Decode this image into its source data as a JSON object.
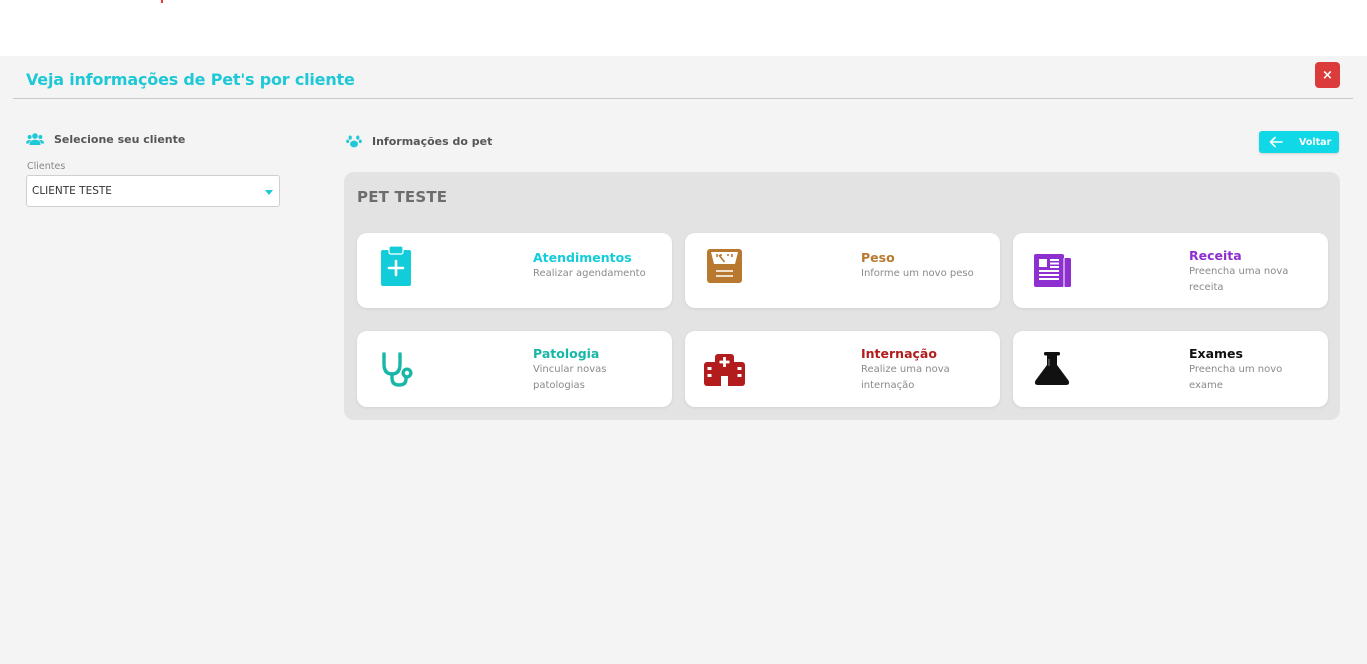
{
  "modal": {
    "title": "Veja informações de Pet's por cliente",
    "close_label": "×"
  },
  "client_section": {
    "heading": "Selecione seu cliente",
    "field_label": "Clientes",
    "selected_value": "CLIENTE TESTE"
  },
  "pet_section": {
    "heading": "Informações do pet",
    "back_label": "Voltar",
    "pet_name": "PET TESTE"
  },
  "cards": [
    {
      "title": "Atendimentos",
      "desc": "Realizar agendamento",
      "color": "#13ccd9",
      "icon": "clipboard-plus-icon"
    },
    {
      "title": "Peso",
      "desc": "Informe um novo peso",
      "color": "#b8782f",
      "icon": "scale-icon"
    },
    {
      "title": "Receita",
      "desc": "Preencha uma nova receita",
      "color": "#8e2fcf",
      "icon": "newspaper-icon"
    },
    {
      "title": "Patologia",
      "desc": "Vincular novas patologias",
      "color": "#17b7a8",
      "icon": "stethoscope-icon"
    },
    {
      "title": "Internação",
      "desc": "Realize uma nova internação",
      "color": "#b21c1c",
      "icon": "hospital-icon"
    },
    {
      "title": "Exames",
      "desc": "Preencha um novo exame",
      "color": "#111111",
      "icon": "flask-icon"
    }
  ],
  "colors": {
    "accent": "#1ec8d6",
    "close": "#dc3b3b",
    "button": "#10d8e6"
  }
}
